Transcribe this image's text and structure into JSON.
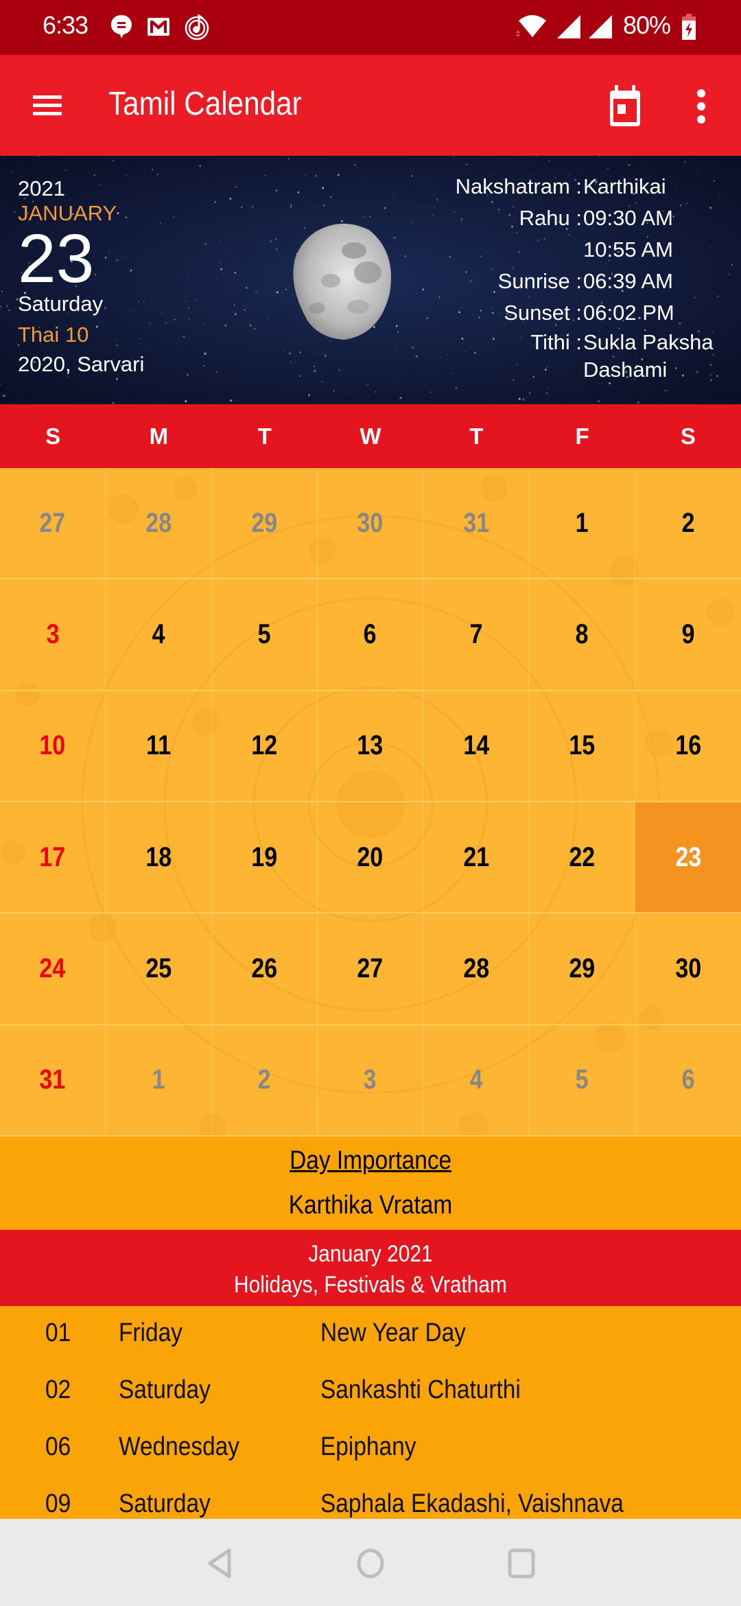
{
  "status_bar": {
    "time": "6:33",
    "battery": "80%",
    "icons": [
      "chat-notification-icon",
      "gmail-icon",
      "music-app-icon",
      "wifi-icon",
      "signal-icon",
      "signal-icon-2",
      "battery-charging-icon"
    ]
  },
  "app_bar": {
    "title": "Tamil Calendar",
    "menu_icon": "hamburger-menu-icon",
    "today_icon": "calendar-today-icon",
    "more_icon": "more-vert-icon"
  },
  "hero": {
    "year": "2021",
    "month": "JANUARY",
    "day": "23",
    "weekday": "Saturday",
    "tamil_date": "Thai 10",
    "tamil_year": "2020, Sarvari",
    "moon_icon": "moon-phase-image",
    "info": [
      {
        "label": "Nakshatram :",
        "value": "Karthikai"
      },
      {
        "label": "Rahu :",
        "value": "09:30 AM"
      },
      {
        "label": "",
        "value": "10:55 AM"
      },
      {
        "label": "Sunrise :",
        "value": "06:39 AM"
      },
      {
        "label": "Sunset :",
        "value": "06:02 PM"
      },
      {
        "label": "Tithi :",
        "value": "Sukla Paksha Dashami"
      }
    ]
  },
  "weekdays": [
    "S",
    "M",
    "T",
    "W",
    "T",
    "F",
    "S"
  ],
  "calendar": {
    "selected": "23",
    "cells": [
      {
        "d": "27",
        "type": "other"
      },
      {
        "d": "28",
        "type": "other"
      },
      {
        "d": "29",
        "type": "other"
      },
      {
        "d": "30",
        "type": "other"
      },
      {
        "d": "31",
        "type": "other"
      },
      {
        "d": "1",
        "type": "normal"
      },
      {
        "d": "2",
        "type": "normal"
      },
      {
        "d": "3",
        "type": "sunday"
      },
      {
        "d": "4",
        "type": "normal"
      },
      {
        "d": "5",
        "type": "normal"
      },
      {
        "d": "6",
        "type": "normal"
      },
      {
        "d": "7",
        "type": "normal"
      },
      {
        "d": "8",
        "type": "normal"
      },
      {
        "d": "9",
        "type": "normal"
      },
      {
        "d": "10",
        "type": "sunday"
      },
      {
        "d": "11",
        "type": "normal"
      },
      {
        "d": "12",
        "type": "normal"
      },
      {
        "d": "13",
        "type": "normal"
      },
      {
        "d": "14",
        "type": "normal"
      },
      {
        "d": "15",
        "type": "normal"
      },
      {
        "d": "16",
        "type": "normal"
      },
      {
        "d": "17",
        "type": "sunday"
      },
      {
        "d": "18",
        "type": "normal"
      },
      {
        "d": "19",
        "type": "normal"
      },
      {
        "d": "20",
        "type": "normal"
      },
      {
        "d": "21",
        "type": "normal"
      },
      {
        "d": "22",
        "type": "normal"
      },
      {
        "d": "23",
        "type": "selected"
      },
      {
        "d": "24",
        "type": "sunday"
      },
      {
        "d": "25",
        "type": "normal"
      },
      {
        "d": "26",
        "type": "normal"
      },
      {
        "d": "27",
        "type": "normal"
      },
      {
        "d": "28",
        "type": "normal"
      },
      {
        "d": "29",
        "type": "normal"
      },
      {
        "d": "30",
        "type": "normal"
      },
      {
        "d": "31",
        "type": "sunday"
      },
      {
        "d": "1",
        "type": "other"
      },
      {
        "d": "2",
        "type": "other"
      },
      {
        "d": "3",
        "type": "other"
      },
      {
        "d": "4",
        "type": "other"
      },
      {
        "d": "5",
        "type": "other"
      },
      {
        "d": "6",
        "type": "other"
      }
    ]
  },
  "day_importance": {
    "title": "Day Importance",
    "value": "Karthika Vratam"
  },
  "month_band": {
    "line1": "January 2021",
    "line2": "Holidays, Festivals & Vratham"
  },
  "holidays": [
    {
      "date": "01",
      "weekday": "Friday",
      "name": "New Year Day"
    },
    {
      "date": "02",
      "weekday": "Saturday",
      "name": "Sankashti Chaturthi"
    },
    {
      "date": "06",
      "weekday": "Wednesday",
      "name": "Epiphany"
    },
    {
      "date": "09",
      "weekday": "Saturday",
      "name": "Saphala Ekadashi, Vaishnava"
    }
  ],
  "nav_bar": {
    "back_icon": "back-icon",
    "home_icon": "home-icon",
    "recents_icon": "recents-icon"
  },
  "colors": {
    "status_bar": "#a8000f",
    "app_bar": "#ec1c27",
    "weekday_header": "#e4151f",
    "grid_bg": "#fdb533",
    "selected_day": "#f59321",
    "sunday_text": "#e8060d",
    "other_month_text": "#878787",
    "accent_orange": "#f29a36",
    "section_bg": "#fba408"
  }
}
